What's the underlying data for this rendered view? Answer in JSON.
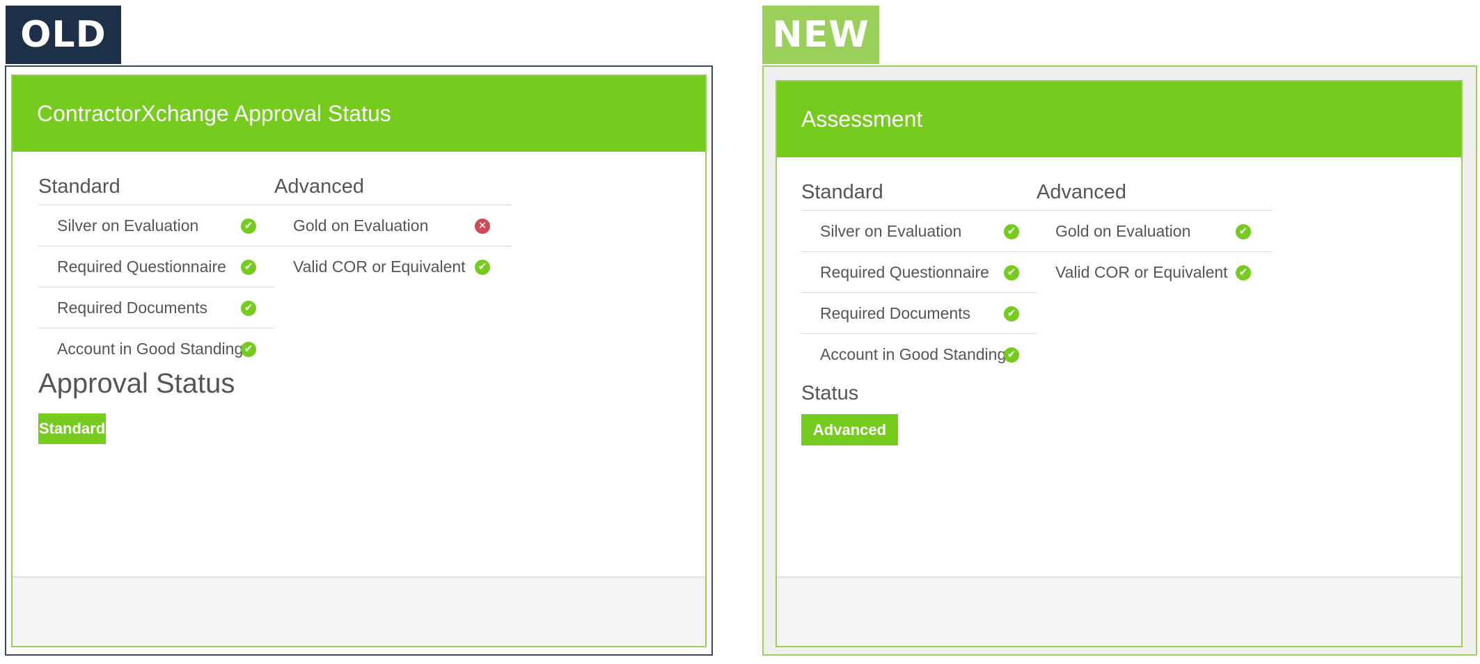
{
  "old": {
    "tag": "OLD",
    "title": "ContractorXchange Approval Status",
    "standard_heading": "Standard",
    "advanced_heading": "Advanced",
    "standard_items": [
      {
        "label": "Silver on Evaluation",
        "status": "pass"
      },
      {
        "label": "Required Questionnaire",
        "status": "pass"
      },
      {
        "label": "Required Documents",
        "status": "pass"
      },
      {
        "label": "Account in Good Standing",
        "status": "pass"
      }
    ],
    "advanced_items": [
      {
        "label": "Gold on Evaluation",
        "status": "fail"
      },
      {
        "label": "Valid COR or Equivalent",
        "status": "pass"
      }
    ],
    "status_heading": "Approval Status",
    "status_badge": "Standard"
  },
  "new": {
    "tag": "NEW",
    "title": "Assessment",
    "standard_heading": "Standard",
    "advanced_heading": "Advanced",
    "standard_items": [
      {
        "label": "Silver on Evaluation",
        "status": "pass"
      },
      {
        "label": "Required Questionnaire",
        "status": "pass"
      },
      {
        "label": "Required Documents",
        "status": "pass"
      },
      {
        "label": "Account in Good Standing",
        "status": "pass"
      }
    ],
    "advanced_items": [
      {
        "label": "Gold on Evaluation",
        "status": "pass"
      },
      {
        "label": "Valid COR or Equivalent",
        "status": "pass"
      }
    ],
    "status_heading": "Status",
    "status_badge": "Advanced"
  },
  "icons": {
    "pass": "check-circle-icon",
    "fail": "x-circle-icon"
  },
  "colors": {
    "accent": "#76cb1f",
    "old_tag": "#1c3048",
    "new_tag": "#9ad05a",
    "fail": "#cf4a55"
  }
}
